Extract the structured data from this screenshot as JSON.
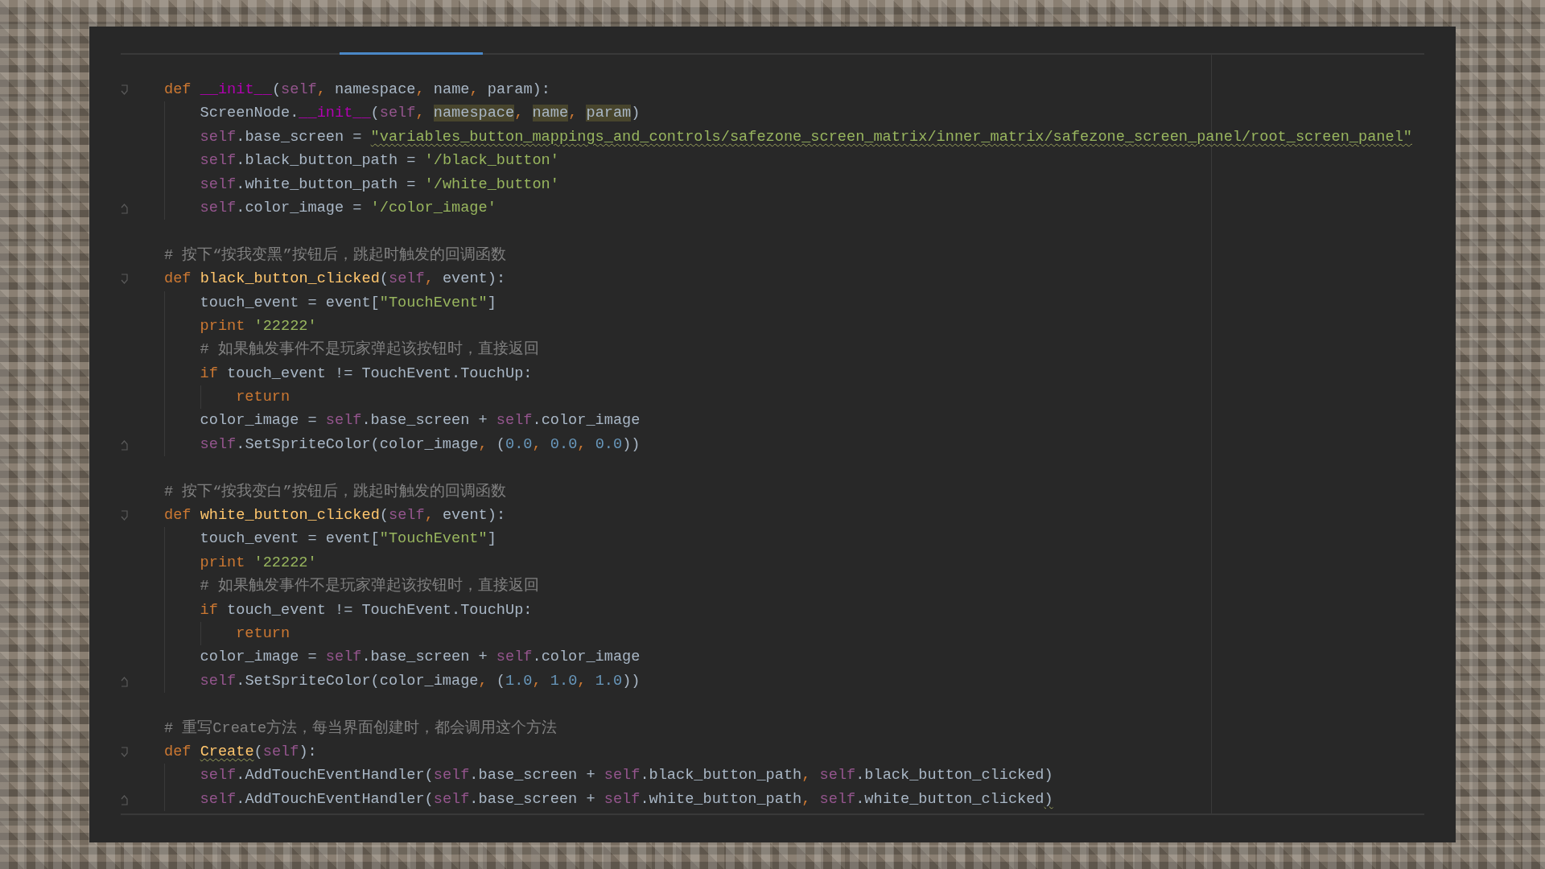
{
  "editor": {
    "lines": [
      {
        "kind": "fold-start",
        "tokens": [
          {
            "kind": "kw",
            "t": "def "
          },
          {
            "kind": "magic",
            "t": "__init__"
          },
          {
            "kind": "plain",
            "t": "("
          },
          {
            "kind": "self",
            "t": "self"
          },
          {
            "kind": "kw",
            "t": ", "
          },
          {
            "kind": "plain",
            "t": "namespace"
          },
          {
            "kind": "kw",
            "t": ", "
          },
          {
            "kind": "plain",
            "t": "name"
          },
          {
            "kind": "kw",
            "t": ", "
          },
          {
            "kind": "plain",
            "t": "param):"
          }
        ],
        "children": [
          {
            "kind": "code",
            "tokens": [
              {
                "kind": "plain",
                "t": "ScreenNode."
              },
              {
                "kind": "magic",
                "t": "__init__"
              },
              {
                "kind": "plain",
                "t": "("
              },
              {
                "kind": "self",
                "t": "self"
              },
              {
                "kind": "kw",
                "t": ", "
              },
              {
                "kind": "hl",
                "t": "namespace"
              },
              {
                "kind": "kw",
                "t": ", "
              },
              {
                "kind": "hl",
                "t": "name"
              },
              {
                "kind": "kw",
                "t": ", "
              },
              {
                "kind": "hl",
                "t": "param"
              },
              {
                "kind": "plain",
                "t": ")"
              }
            ]
          },
          {
            "kind": "code",
            "tokens": [
              {
                "kind": "self",
                "t": "self"
              },
              {
                "kind": "plain",
                "t": ".base_screen = "
              },
              {
                "kind": "str",
                "t": "\"variables_button_mappings_and_controls/safezone_screen_matrix/inner_matrix/safezone_screen_panel/root_screen_panel\"",
                "warning": true
              }
            ]
          },
          {
            "kind": "code",
            "tokens": [
              {
                "kind": "self",
                "t": "self"
              },
              {
                "kind": "plain",
                "t": ".black_button_path = "
              },
              {
                "kind": "str",
                "t": "'/black_button'"
              }
            ]
          },
          {
            "kind": "code",
            "tokens": [
              {
                "kind": "self",
                "t": "self"
              },
              {
                "kind": "plain",
                "t": ".white_button_path = "
              },
              {
                "kind": "str",
                "t": "'/white_button'"
              }
            ]
          },
          {
            "kind": "fold-end",
            "tokens": [
              {
                "kind": "self",
                "t": "self"
              },
              {
                "kind": "plain",
                "t": ".color_image = "
              },
              {
                "kind": "str",
                "t": "'/color_image'"
              }
            ]
          }
        ]
      },
      {
        "kind": "blank"
      },
      {
        "kind": "code",
        "tokens": [
          {
            "kind": "comment",
            "t": "# 按下“按我变黑”按钮后，跳起时触发的回调函数"
          }
        ]
      },
      {
        "kind": "fold-start",
        "tokens": [
          {
            "kind": "kw",
            "t": "def "
          },
          {
            "kind": "fn",
            "t": "black_button_clicked"
          },
          {
            "kind": "plain",
            "t": "("
          },
          {
            "kind": "self",
            "t": "self"
          },
          {
            "kind": "kw",
            "t": ", "
          },
          {
            "kind": "plain",
            "t": "event):"
          }
        ],
        "children": [
          {
            "kind": "code",
            "tokens": [
              {
                "kind": "plain",
                "t": "touch_event = event["
              },
              {
                "kind": "str",
                "t": "\"TouchEvent\""
              },
              {
                "kind": "plain",
                "t": "]"
              }
            ]
          },
          {
            "kind": "code",
            "tokens": [
              {
                "kind": "kw",
                "t": "print "
              },
              {
                "kind": "str",
                "t": "'22222'"
              }
            ]
          },
          {
            "kind": "code",
            "tokens": [
              {
                "kind": "comment",
                "t": "# 如果触发事件不是玩家弹起该按钮时，直接返回"
              }
            ]
          },
          {
            "kind": "code",
            "tokens": [
              {
                "kind": "kw",
                "t": "if "
              },
              {
                "kind": "plain",
                "t": "touch_event != TouchEvent.TouchUp:"
              }
            ],
            "children": [
              {
                "kind": "code",
                "tokens": [
                  {
                    "kind": "kw",
                    "t": "return"
                  }
                ]
              }
            ]
          },
          {
            "kind": "code",
            "tokens": [
              {
                "kind": "plain",
                "t": "color_image = "
              },
              {
                "kind": "self",
                "t": "self"
              },
              {
                "kind": "plain",
                "t": ".base_screen + "
              },
              {
                "kind": "self",
                "t": "self"
              },
              {
                "kind": "plain",
                "t": ".color_image"
              }
            ]
          },
          {
            "kind": "fold-end",
            "tokens": [
              {
                "kind": "self",
                "t": "self"
              },
              {
                "kind": "plain",
                "t": ".SetSpriteColor(color_image"
              },
              {
                "kind": "kw",
                "t": ", "
              },
              {
                "kind": "plain",
                "t": "("
              },
              {
                "kind": "num",
                "t": "0.0"
              },
              {
                "kind": "kw",
                "t": ", "
              },
              {
                "kind": "num",
                "t": "0.0"
              },
              {
                "kind": "kw",
                "t": ", "
              },
              {
                "kind": "num",
                "t": "0.0"
              },
              {
                "kind": "plain",
                "t": "))"
              }
            ]
          }
        ]
      },
      {
        "kind": "blank"
      },
      {
        "kind": "code",
        "tokens": [
          {
            "kind": "comment",
            "t": "# 按下“按我变白”按钮后，跳起时触发的回调函数"
          }
        ]
      },
      {
        "kind": "fold-start",
        "tokens": [
          {
            "kind": "kw",
            "t": "def "
          },
          {
            "kind": "fn",
            "t": "white_button_clicked"
          },
          {
            "kind": "plain",
            "t": "("
          },
          {
            "kind": "self",
            "t": "self"
          },
          {
            "kind": "kw",
            "t": ", "
          },
          {
            "kind": "plain",
            "t": "event):"
          }
        ],
        "children": [
          {
            "kind": "code",
            "tokens": [
              {
                "kind": "plain",
                "t": "touch_event = event["
              },
              {
                "kind": "str",
                "t": "\"TouchEvent\""
              },
              {
                "kind": "plain",
                "t": "]"
              }
            ]
          },
          {
            "kind": "code",
            "tokens": [
              {
                "kind": "kw",
                "t": "print "
              },
              {
                "kind": "str",
                "t": "'22222'"
              }
            ]
          },
          {
            "kind": "code",
            "tokens": [
              {
                "kind": "comment",
                "t": "# 如果触发事件不是玩家弹起该按钮时，直接返回"
              }
            ]
          },
          {
            "kind": "code",
            "tokens": [
              {
                "kind": "kw",
                "t": "if "
              },
              {
                "kind": "plain",
                "t": "touch_event != TouchEvent.TouchUp:"
              }
            ],
            "children": [
              {
                "kind": "code",
                "tokens": [
                  {
                    "kind": "kw",
                    "t": "return"
                  }
                ]
              }
            ]
          },
          {
            "kind": "code",
            "tokens": [
              {
                "kind": "plain",
                "t": "color_image = "
              },
              {
                "kind": "self",
                "t": "self"
              },
              {
                "kind": "plain",
                "t": ".base_screen + "
              },
              {
                "kind": "self",
                "t": "self"
              },
              {
                "kind": "plain",
                "t": ".color_image"
              }
            ]
          },
          {
            "kind": "fold-end",
            "tokens": [
              {
                "kind": "self",
                "t": "self"
              },
              {
                "kind": "plain",
                "t": ".SetSpriteColor(color_image"
              },
              {
                "kind": "kw",
                "t": ", "
              },
              {
                "kind": "plain",
                "t": "("
              },
              {
                "kind": "num",
                "t": "1.0"
              },
              {
                "kind": "kw",
                "t": ", "
              },
              {
                "kind": "num",
                "t": "1.0"
              },
              {
                "kind": "kw",
                "t": ", "
              },
              {
                "kind": "num",
                "t": "1.0"
              },
              {
                "kind": "plain",
                "t": "))"
              }
            ]
          }
        ]
      },
      {
        "kind": "blank"
      },
      {
        "kind": "code",
        "tokens": [
          {
            "kind": "comment",
            "t": "# 重写Create方法，每当界面创建时，都会调用这个方法"
          }
        ]
      },
      {
        "kind": "fold-start",
        "tokens": [
          {
            "kind": "kw",
            "t": "def "
          },
          {
            "kind": "fn",
            "t": "Create",
            "warning": true
          },
          {
            "kind": "plain",
            "t": "("
          },
          {
            "kind": "self",
            "t": "self"
          },
          {
            "kind": "plain",
            "t": "):"
          }
        ],
        "children": [
          {
            "kind": "code",
            "tokens": [
              {
                "kind": "self",
                "t": "self"
              },
              {
                "kind": "plain",
                "t": ".AddTouchEventHandler("
              },
              {
                "kind": "self",
                "t": "self"
              },
              {
                "kind": "plain",
                "t": ".base_screen + "
              },
              {
                "kind": "self",
                "t": "self"
              },
              {
                "kind": "plain",
                "t": ".black_button_path"
              },
              {
                "kind": "kw",
                "t": ", "
              },
              {
                "kind": "self",
                "t": "self"
              },
              {
                "kind": "plain",
                "t": ".black_button_clicked)"
              }
            ]
          },
          {
            "kind": "fold-end",
            "tokens": [
              {
                "kind": "self",
                "t": "self"
              },
              {
                "kind": "plain",
                "t": ".AddTouchEventHandler("
              },
              {
                "kind": "self",
                "t": "self"
              },
              {
                "kind": "plain",
                "t": ".base_screen + "
              },
              {
                "kind": "self",
                "t": "self"
              },
              {
                "kind": "plain",
                "t": ".white_button_path"
              },
              {
                "kind": "kw",
                "t": ", "
              },
              {
                "kind": "self",
                "t": "self"
              },
              {
                "kind": "plain",
                "t": ".white_button_clicked"
              },
              {
                "kind": "plain",
                "t": ")",
                "warning": true
              }
            ]
          }
        ]
      }
    ]
  }
}
